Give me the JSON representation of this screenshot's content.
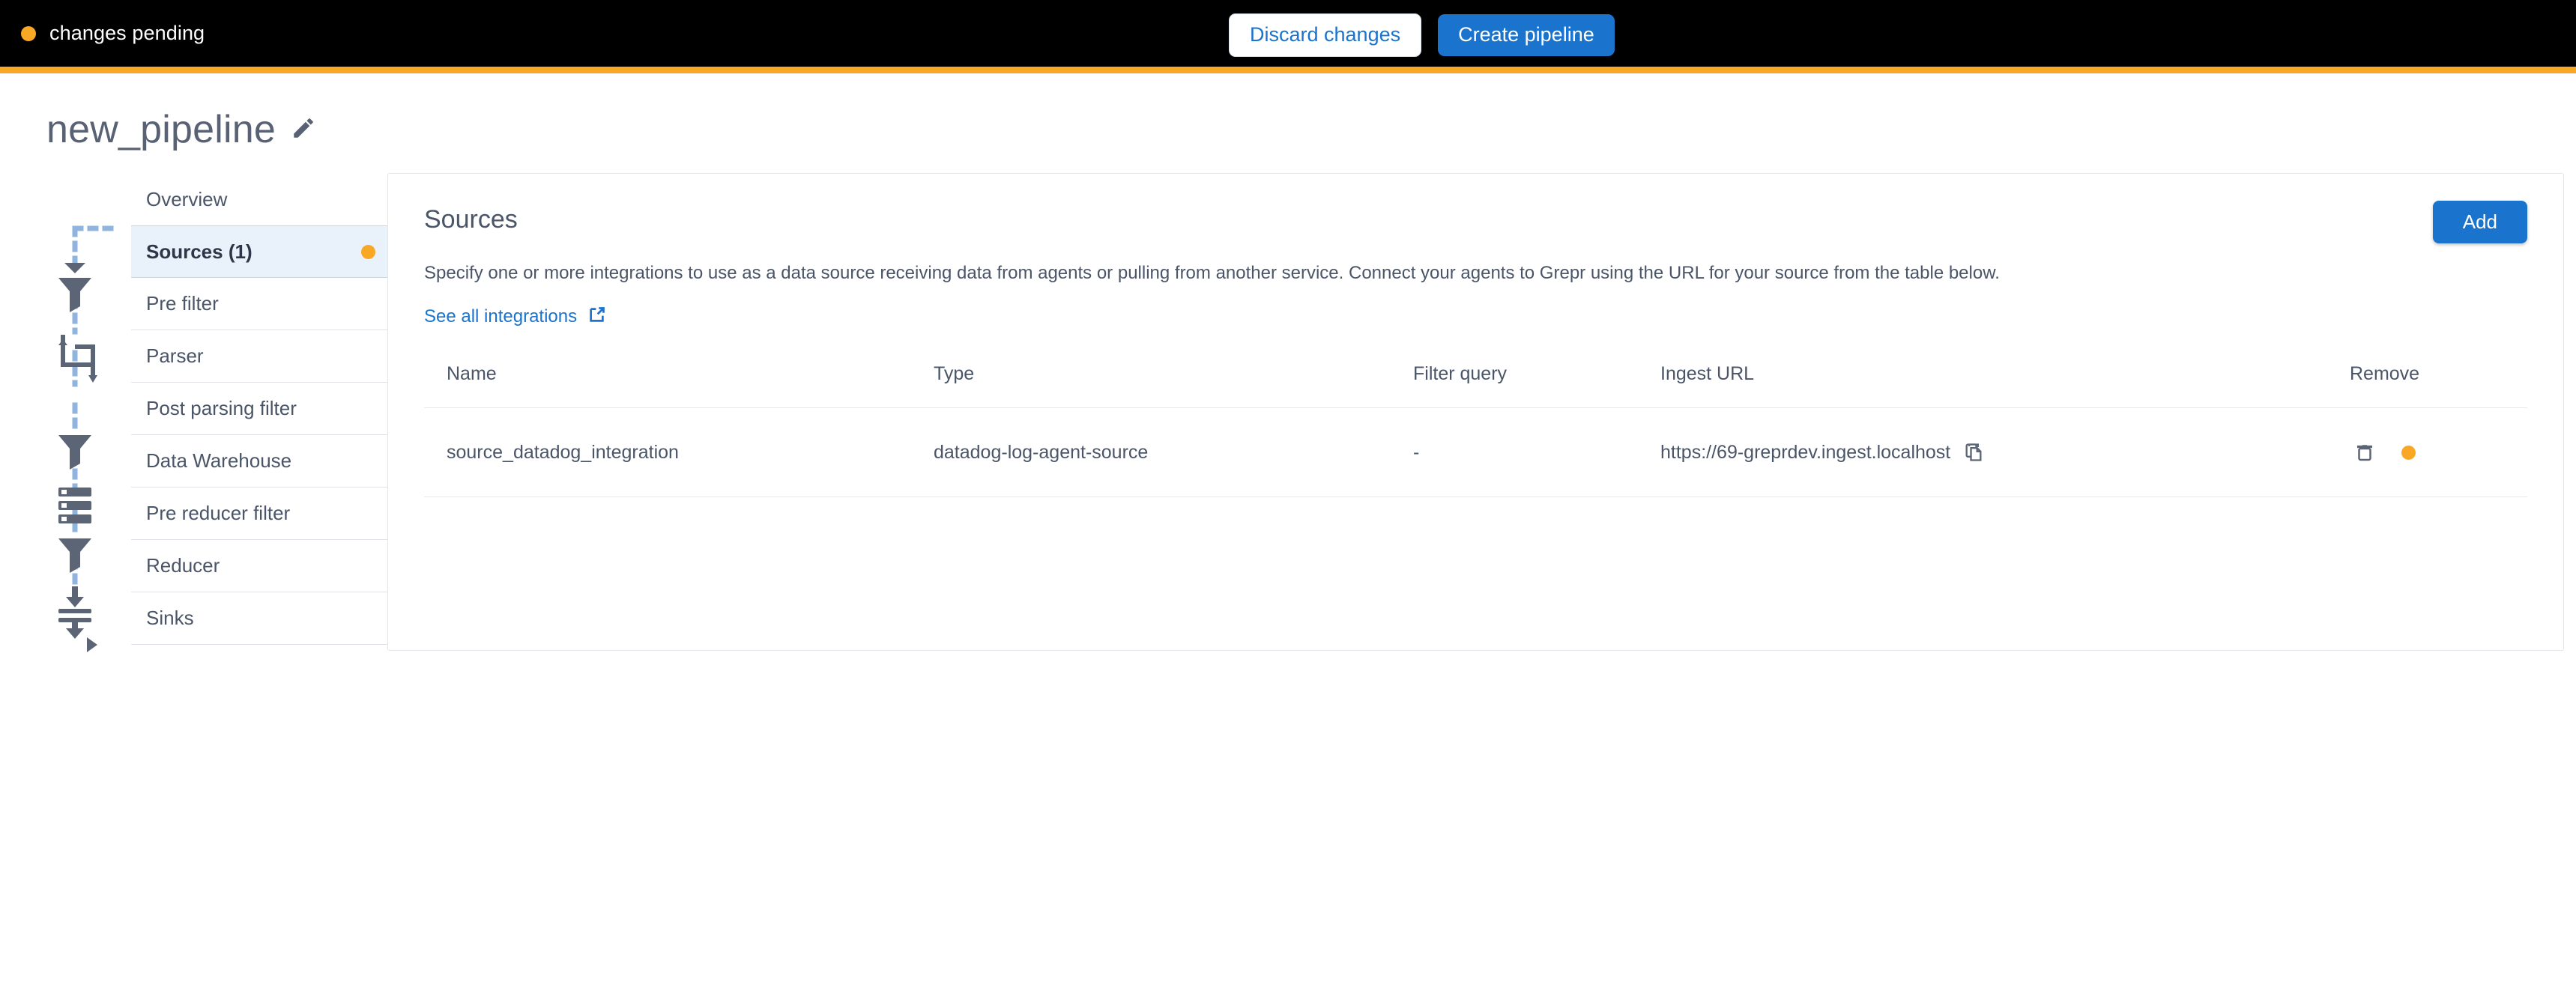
{
  "topbar": {
    "status_text": "changes pending",
    "status_color": "#F9A826",
    "discard_label": "Discard changes",
    "create_label": "Create pipeline",
    "accent_color": "#F9A826"
  },
  "page": {
    "title": "new_pipeline",
    "edit_icon": "pencil-icon"
  },
  "sidebar": {
    "items": [
      {
        "label": "Overview",
        "active": false,
        "has_dot": false,
        "icon": null
      },
      {
        "label": "Sources (1)",
        "active": true,
        "has_dot": true,
        "icon": "arrow-right-icon"
      },
      {
        "label": "Pre filter",
        "active": false,
        "has_dot": false,
        "icon": "filter-funnel-icon"
      },
      {
        "label": "Parser",
        "active": false,
        "has_dot": false,
        "icon": "crop-parser-icon"
      },
      {
        "label": "Post parsing filter",
        "active": false,
        "has_dot": false,
        "icon": "filter-funnel-icon"
      },
      {
        "label": "Data Warehouse",
        "active": false,
        "has_dot": false,
        "icon": "database-icon"
      },
      {
        "label": "Pre reducer filter",
        "active": false,
        "has_dot": false,
        "icon": "filter-funnel-icon"
      },
      {
        "label": "Reducer",
        "active": false,
        "has_dot": false,
        "icon": "reducer-icon"
      },
      {
        "label": "Sinks",
        "active": false,
        "has_dot": false,
        "icon": "arrow-right-icon"
      }
    ]
  },
  "panel": {
    "title": "Sources",
    "description": "Specify one or more integrations to use as a data source receiving data from agents or pulling from another service. Connect your agents to Grepr using the URL for your source from the table below.",
    "link_label": "See all integrations",
    "link_icon": "external-link-icon",
    "add_label": "Add",
    "accent_blue": "#1a73cc"
  },
  "table": {
    "columns": [
      "Name",
      "Type",
      "Filter query",
      "Ingest URL",
      "Remove"
    ],
    "rows": [
      {
        "name": "source_datadog_integration",
        "type": "datadog-log-agent-source",
        "filter_query": "-",
        "ingest_url": "https://69-greprdev.ingest.localhost",
        "copy_icon": "copy-icon",
        "remove_icon": "trash-icon",
        "status_dot": "#F9A826"
      }
    ]
  }
}
